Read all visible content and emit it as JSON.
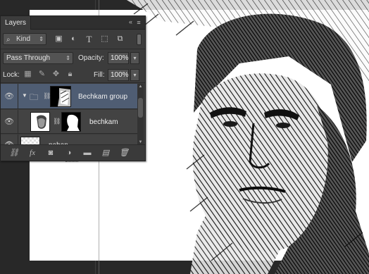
{
  "panel": {
    "tab_label": "Layers",
    "collapse_glyph": "«",
    "menu_glyph": "≡"
  },
  "filter": {
    "kind_label": "Kind",
    "icons": [
      "image-filter-icon",
      "adjustment-filter-icon",
      "type-filter-icon",
      "shape-filter-icon",
      "smart-object-filter-icon"
    ]
  },
  "blend": {
    "mode": "Pass Through",
    "opacity_label": "Opacity:",
    "opacity_value": "100%",
    "fill_label": "Fill:",
    "fill_value": "100%",
    "lock_label": "Lock:"
  },
  "layers": [
    {
      "name": "Bechkam group",
      "type": "group",
      "selected": true,
      "visible": true
    },
    {
      "name": "bechkam",
      "type": "masked-layer",
      "selected": false,
      "visible": true
    },
    {
      "name": "pohon",
      "type": "layer",
      "selected": false,
      "visible": true
    }
  ],
  "footer_icons": [
    "link-layers-icon",
    "fx-icon",
    "add-mask-icon",
    "adjustment-layer-icon",
    "new-group-icon",
    "new-layer-icon",
    "delete-layer-icon"
  ],
  "colors": {
    "panel_bg": "#3c3c3c",
    "selected_row": "#4f5d73",
    "workspace": "#282828",
    "canvas": "#ffffff"
  }
}
